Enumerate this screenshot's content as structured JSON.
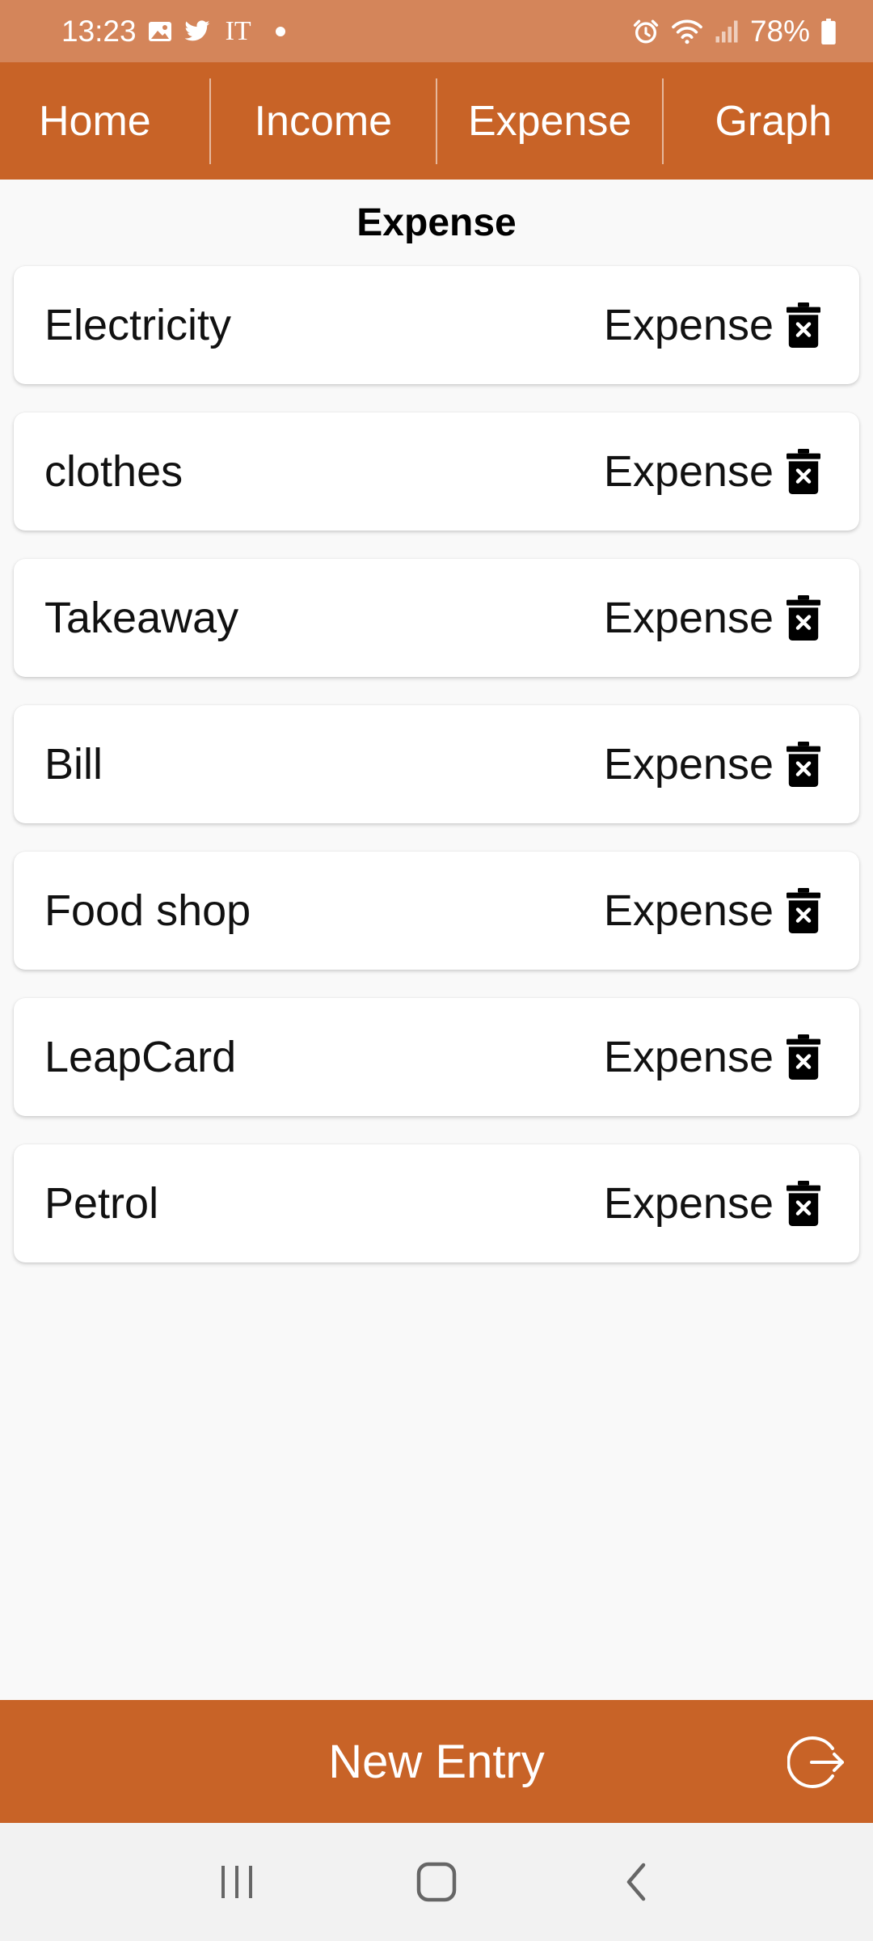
{
  "status_bar": {
    "time": "13:23",
    "carrier_text": "IT",
    "battery": "78%"
  },
  "nav": {
    "tabs": [
      {
        "label": "Home"
      },
      {
        "label": "Income"
      },
      {
        "label": "Expense"
      },
      {
        "label": "Graph"
      }
    ]
  },
  "page": {
    "title": "Expense"
  },
  "entries": [
    {
      "name": "Electricity",
      "type": "Expense"
    },
    {
      "name": "clothes",
      "type": "Expense"
    },
    {
      "name": "Takeaway",
      "type": "Expense"
    },
    {
      "name": "Bill",
      "type": "Expense"
    },
    {
      "name": "Food shop",
      "type": "Expense"
    },
    {
      "name": "LeapCard",
      "type": "Expense"
    },
    {
      "name": "Petrol",
      "type": "Expense"
    }
  ],
  "bottom_bar": {
    "new_entry_label": "New Entry"
  },
  "icons": {
    "delete": "trash-icon",
    "logout": "logout-icon",
    "recent_apps": "recent-apps-icon",
    "home": "home-icon",
    "back": "back-icon"
  },
  "colors": {
    "primary": "#c86327",
    "status_bar": "#d4855a",
    "background": "#f9f9f9"
  }
}
